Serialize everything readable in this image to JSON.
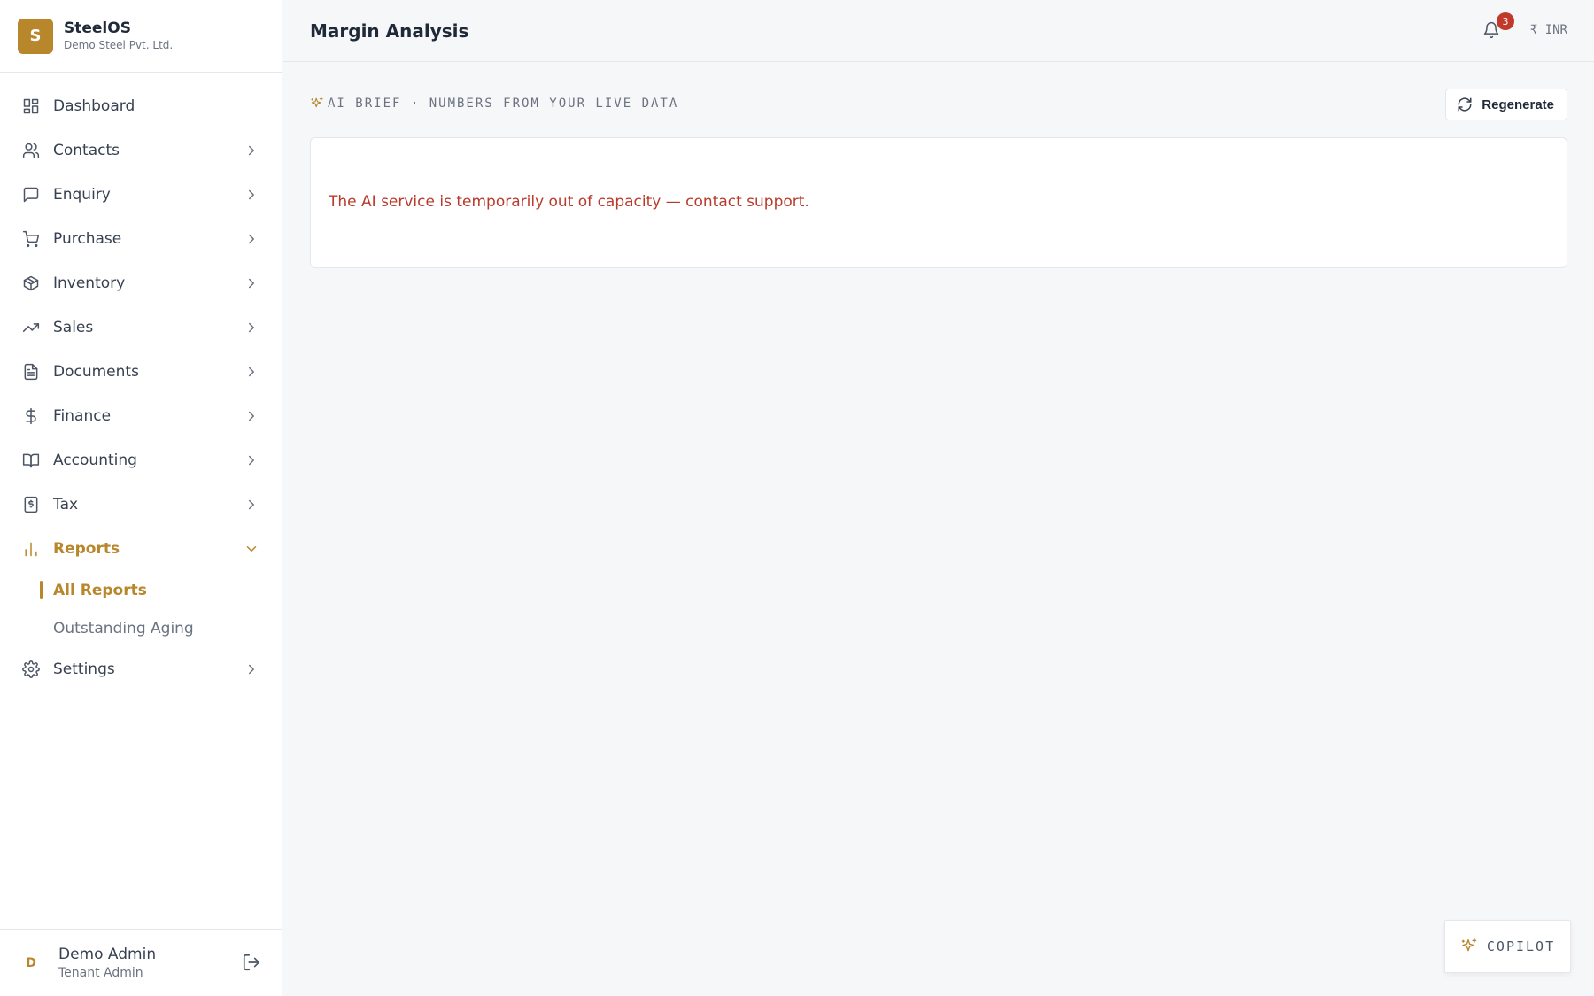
{
  "brand": {
    "logo_letter": "S",
    "name": "SteelOS",
    "company": "Demo Steel Pvt. Ltd."
  },
  "sidebar": {
    "items": [
      {
        "label": "Dashboard",
        "icon": "dashboard-icon"
      },
      {
        "label": "Contacts",
        "icon": "users-icon"
      },
      {
        "label": "Enquiry",
        "icon": "message-icon"
      },
      {
        "label": "Purchase",
        "icon": "cart-icon"
      },
      {
        "label": "Inventory",
        "icon": "package-icon"
      },
      {
        "label": "Sales",
        "icon": "trending-up-icon"
      },
      {
        "label": "Documents",
        "icon": "document-icon"
      },
      {
        "label": "Finance",
        "icon": "dollar-icon"
      },
      {
        "label": "Accounting",
        "icon": "book-icon"
      },
      {
        "label": "Tax",
        "icon": "receipt-icon"
      },
      {
        "label": "Reports",
        "icon": "bar-chart-icon"
      },
      {
        "label": "Settings",
        "icon": "gear-icon"
      }
    ],
    "reports_sub": [
      {
        "label": "All Reports"
      },
      {
        "label": "Outstanding Aging"
      }
    ]
  },
  "user": {
    "initial": "D",
    "name": "Demo Admin",
    "role": "Tenant Admin"
  },
  "header": {
    "title": "Margin Analysis",
    "notification_count": "3",
    "currency": "₹ INR"
  },
  "brief": {
    "label": "AI BRIEF · NUMBERS FROM YOUR LIVE DATA",
    "regenerate_label": "Regenerate"
  },
  "card": {
    "error_message": "The AI service is temporarily out of capacity — contact support."
  },
  "copilot": {
    "label": "COPILOT"
  },
  "colors": {
    "accent": "#b8862b",
    "error": "#b93a2b",
    "badge": "#c0392b"
  }
}
